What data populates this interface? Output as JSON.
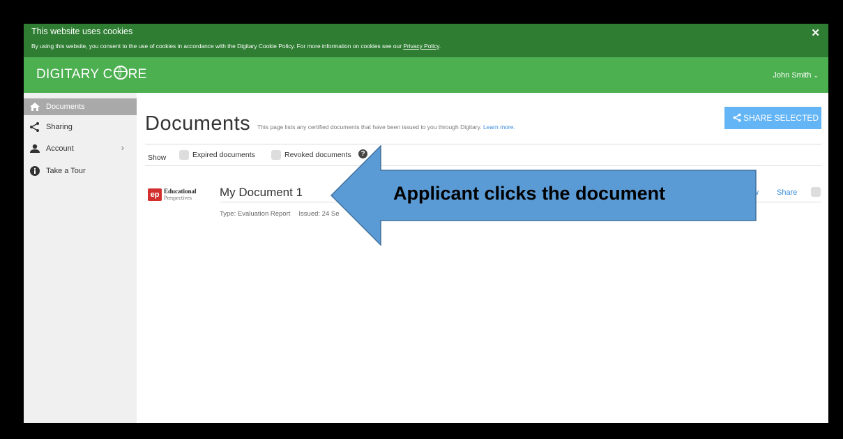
{
  "cookie_banner": {
    "title": "This website uses cookies",
    "text": "By using this website, you consent to the use of cookies in accordance with the Digitary Cookie Policy. For more information on cookies see our",
    "link": "Privacy Policy",
    "link_suffix": ".",
    "close_icon": "close-icon"
  },
  "header": {
    "brand_pre": "DIGITARY C",
    "brand_post": "RE",
    "user_name": "John Smith",
    "user_chevron": "⌄"
  },
  "sidebar": {
    "items": [
      {
        "label": "Documents",
        "icon": "home-icon"
      },
      {
        "label": "Sharing",
        "icon": "share-icon"
      },
      {
        "label": "Account",
        "icon": "user-icon",
        "arrow": "›"
      },
      {
        "label": "Take a Tour",
        "icon": "info-icon"
      }
    ]
  },
  "main": {
    "title": "Documents",
    "description": "This page lists any certified documents that have been issued to you through Digitary.",
    "learn_more": "Learn more.",
    "share_selected": "SHARE SELECTED",
    "filters": {
      "show": "Show",
      "expired": "Expired documents",
      "revoked": "Revoked documents",
      "help": "?"
    },
    "document": {
      "logo_line1": "Educational",
      "logo_line2": "Perspectives",
      "logo_mark": "ep",
      "title": "My Document 1",
      "type": "Type: Evaluation Report",
      "issued": "Issued: 24 Se",
      "view": "w",
      "share": "Share"
    }
  },
  "callout": {
    "text": "Applicant clicks the document",
    "fill": "#5b9bd5",
    "stroke": "#41719c"
  }
}
